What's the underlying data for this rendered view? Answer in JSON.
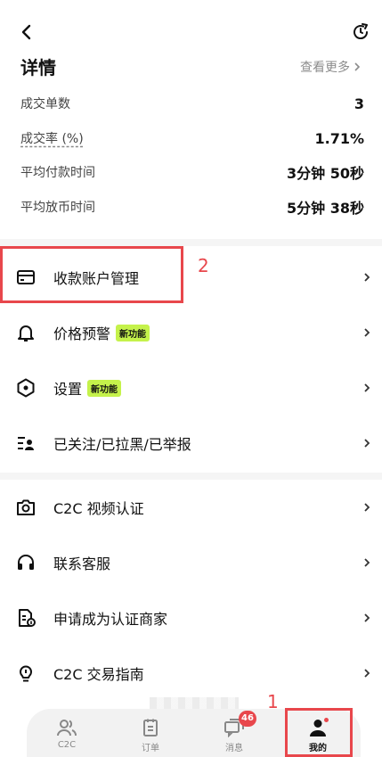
{
  "header": {
    "title": "详情",
    "see_more": "查看更多"
  },
  "stats": [
    {
      "label": "成交单数",
      "value": "3"
    },
    {
      "label": "成交率 (%)",
      "value": "1.71%"
    },
    {
      "label": "平均付款时间",
      "value": "3分钟 50秒"
    },
    {
      "label": "平均放币时间",
      "value": "5分钟 38秒"
    }
  ],
  "menu": {
    "payment_accounts": "收款账户管理",
    "price_alert": "价格预警",
    "settings": "设置",
    "follow_block_report": "已关注/已拉黑/已举报",
    "video_verify": "C2C 视频认证",
    "contact_support": "联系客服",
    "apply_merchant": "申请成为认证商家",
    "trade_guide": "C2C 交易指南",
    "new_badge": "新功能"
  },
  "annotations": {
    "one": "1",
    "two": "2"
  },
  "tabbar": {
    "c2c": "C2C",
    "orders": "订单",
    "messages": "消息",
    "messages_count": "46",
    "me": "我的"
  },
  "colors": {
    "accent_red": "#e8474c",
    "badge_green": "#c5f24b"
  }
}
